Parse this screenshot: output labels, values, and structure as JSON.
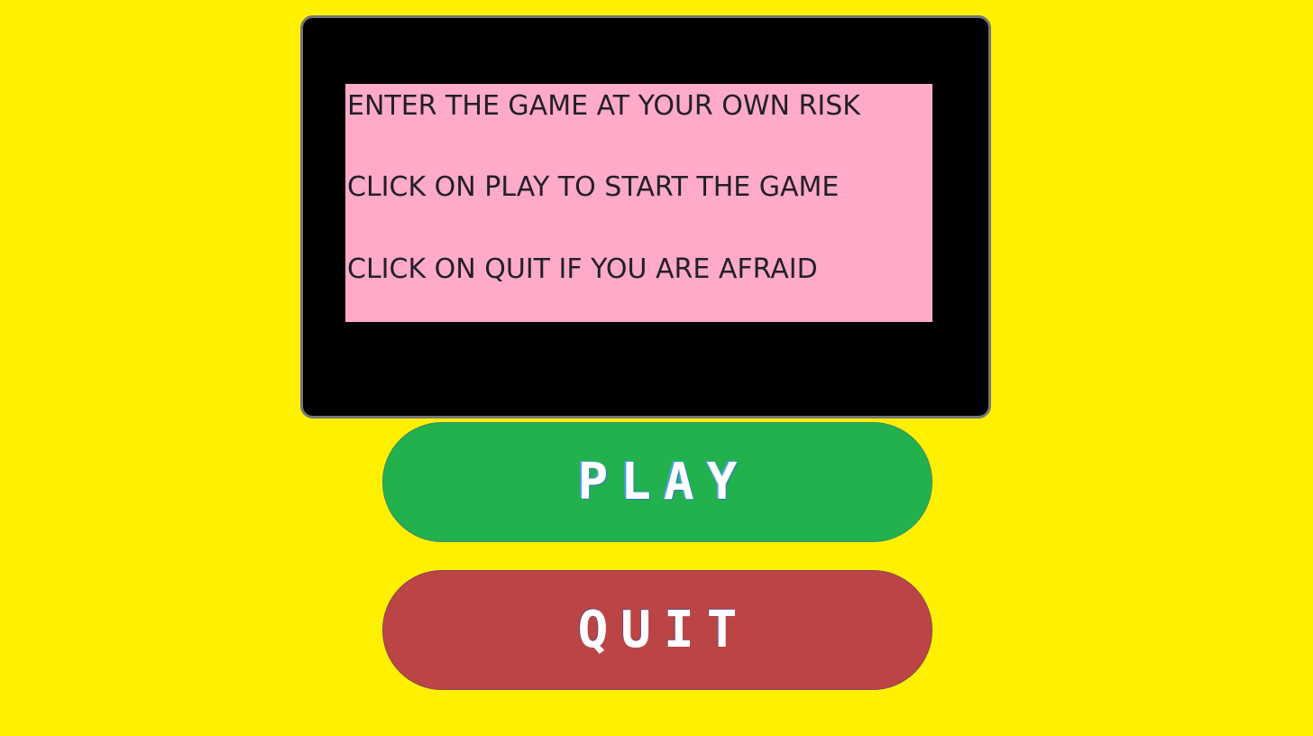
{
  "screen": {
    "lines": [
      "ENTER THE GAME AT YOUR OWN RISK",
      "CLICK ON PLAY TO START THE GAME",
      "CLICK ON QUIT IF YOU ARE AFRAID"
    ]
  },
  "buttons": {
    "play_label": "PLAY",
    "quit_label": "QUIT"
  },
  "colors": {
    "background": "#fff000",
    "screen": "#000000",
    "panel": "#ffaac9",
    "play": "#22b14c",
    "quit": "#bb4444"
  }
}
